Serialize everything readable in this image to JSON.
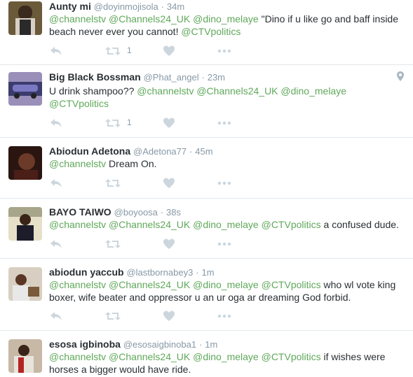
{
  "colors": {
    "mention": "#5fa85a",
    "meta": "#8899a6",
    "icon": "#ccd6dd",
    "divider": "#e1e8ed"
  },
  "tweets": [
    {
      "name": "Aunty mi",
      "handle": "@doyinmojisola",
      "time": "34m",
      "parts": [
        {
          "t": "@channelstv",
          "m": true
        },
        {
          "t": " ",
          "m": false
        },
        {
          "t": "@Channels24_UK",
          "m": true
        },
        {
          "t": " ",
          "m": false
        },
        {
          "t": "@dino_melaye",
          "m": true
        },
        {
          "t": " \"Dino if u like go and baff inside beach never ever you cannot! ",
          "m": false
        },
        {
          "t": "@CTVpolitics",
          "m": true
        }
      ],
      "retweet_count": "1",
      "has_location": false
    },
    {
      "name": "Big Black Bossman",
      "handle": "@Phat_angel",
      "time": "23m",
      "parts": [
        {
          "t": "U drink shampoo?? ",
          "m": false
        },
        {
          "t": "@channelstv",
          "m": true
        },
        {
          "t": " ",
          "m": false
        },
        {
          "t": "@Channels24_UK",
          "m": true
        },
        {
          "t": " ",
          "m": false
        },
        {
          "t": "@dino_melaye",
          "m": true
        },
        {
          "t": " ",
          "m": false
        },
        {
          "t": "@CTVpolitics",
          "m": true
        }
      ],
      "retweet_count": "1",
      "has_location": true
    },
    {
      "name": "Abiodun Adetona",
      "handle": "@Adetona77",
      "time": "45m",
      "parts": [
        {
          "t": "@channelstv",
          "m": true
        },
        {
          "t": " Dream On.",
          "m": false
        }
      ],
      "retweet_count": "",
      "has_location": false
    },
    {
      "name": "BAYO TAIWO",
      "handle": "@boyoosa",
      "time": "38s",
      "parts": [
        {
          "t": "@channelstv",
          "m": true
        },
        {
          "t": " ",
          "m": false
        },
        {
          "t": "@Channels24_UK",
          "m": true
        },
        {
          "t": " ",
          "m": false
        },
        {
          "t": "@dino_melaye",
          "m": true
        },
        {
          "t": " ",
          "m": false
        },
        {
          "t": "@CTVpolitics",
          "m": true
        },
        {
          "t": " a confused dude.",
          "m": false
        }
      ],
      "retweet_count": "",
      "has_location": false
    },
    {
      "name": "abiodun yaccub",
      "handle": "@lastbornabey3",
      "time": "1m",
      "parts": [
        {
          "t": "@channelstv",
          "m": true
        },
        {
          "t": " ",
          "m": false
        },
        {
          "t": "@Channels24_UK",
          "m": true
        },
        {
          "t": " ",
          "m": false
        },
        {
          "t": "@dino_melaye",
          "m": true
        },
        {
          "t": " ",
          "m": false
        },
        {
          "t": "@CTVpolitics",
          "m": true
        },
        {
          "t": " who wl vote king boxer, wife beater and oppressor u an ur oga ar dreaming God forbid.",
          "m": false
        }
      ],
      "retweet_count": "",
      "has_location": false
    },
    {
      "name": "esosa igbinoba",
      "handle": "@esosaigbinoba1",
      "time": "1m",
      "parts": [
        {
          "t": "@channelstv",
          "m": true
        },
        {
          "t": " ",
          "m": false
        },
        {
          "t": "@Channels24_UK",
          "m": true
        },
        {
          "t": " ",
          "m": false
        },
        {
          "t": "@dino_melaye",
          "m": true
        },
        {
          "t": " ",
          "m": false
        },
        {
          "t": "@CTVpolitics",
          "m": true
        },
        {
          "t": " if wishes were horses a bigger would have ride.",
          "m": false
        }
      ],
      "retweet_count": "",
      "has_location": false
    }
  ],
  "icons": {
    "reply": "reply-icon",
    "retweet": "retweet-icon",
    "like": "heart-icon",
    "more": "more-icon",
    "location": "location-pin-icon"
  }
}
